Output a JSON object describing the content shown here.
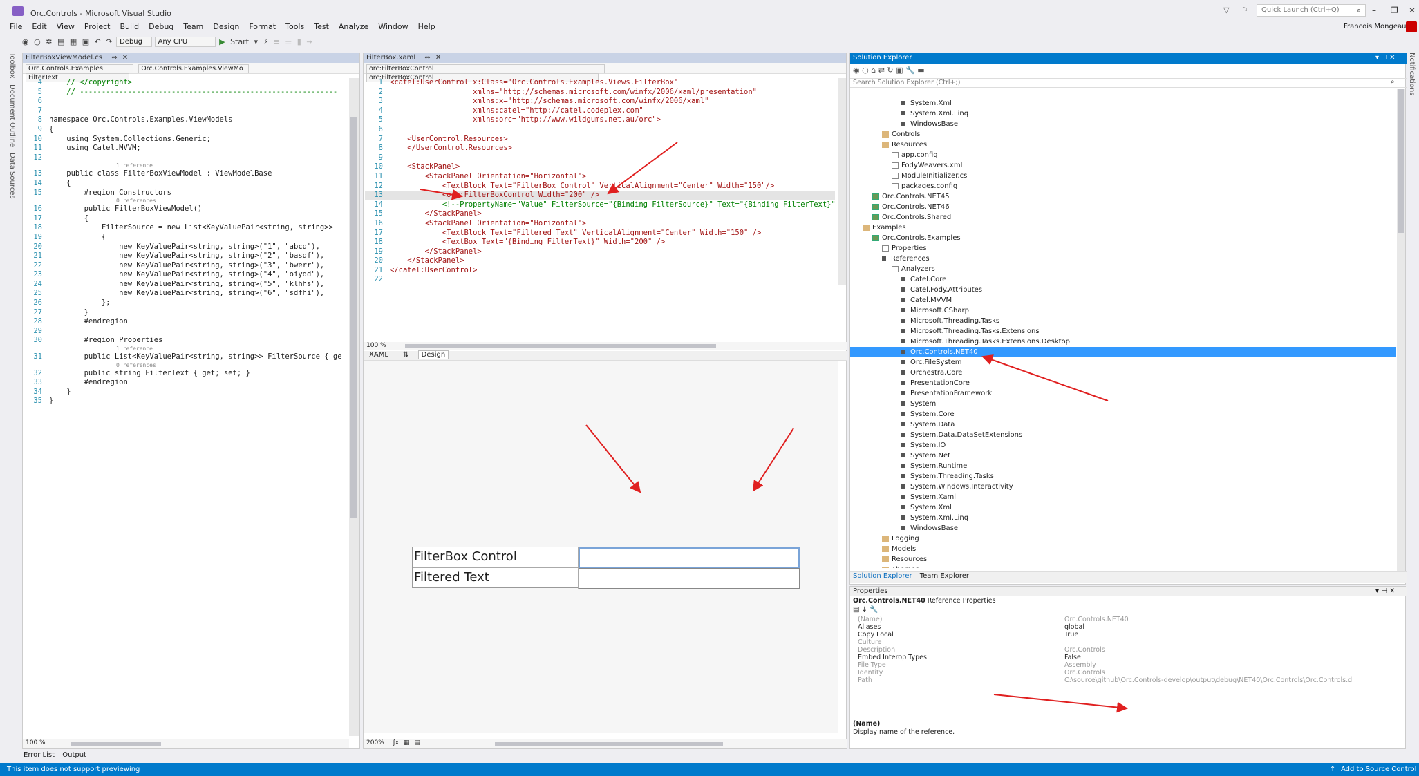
{
  "window": {
    "title": "Orc.Controls - Microsoft Visual Studio",
    "quick_launch_placeholder": "Quick Launch (Ctrl+Q)",
    "user": "Francois Mongeau"
  },
  "menu": [
    "File",
    "Edit",
    "View",
    "Project",
    "Build",
    "Debug",
    "Team",
    "Design",
    "Format",
    "Tools",
    "Test",
    "Analyze",
    "Window",
    "Help"
  ],
  "toolbar": {
    "config": "Debug",
    "platform": "Any CPU",
    "start": "Start"
  },
  "left_tabs": [
    "Toolbox",
    "Document Outline",
    "Data Sources"
  ],
  "right_tabs": [
    "Notifications"
  ],
  "cs_editor": {
    "tab": "FilterBoxViewModel.cs",
    "nav": [
      "Orc.Controls.Examples",
      "Orc.Controls.Examples.ViewMo",
      "FilterText"
    ],
    "zoom": "100 %",
    "lines": [
      {
        "n": "4",
        "t": "    // </copyright>"
      },
      {
        "n": "5",
        "t": "    // -----------------------------------------------------------"
      },
      {
        "n": "6",
        "t": ""
      },
      {
        "n": "7",
        "t": ""
      },
      {
        "n": "8",
        "t": "namespace Orc.Controls.Examples.ViewModels"
      },
      {
        "n": "9",
        "t": "{"
      },
      {
        "n": "10",
        "t": "    using System.Collections.Generic;"
      },
      {
        "n": "11",
        "t": "    using Catel.MVVM;"
      },
      {
        "n": "12",
        "t": ""
      },
      {
        "n": "",
        "t": "1 reference",
        "hint": true
      },
      {
        "n": "13",
        "t": "    public class FilterBoxViewModel : ViewModelBase"
      },
      {
        "n": "14",
        "t": "    {"
      },
      {
        "n": "15",
        "t": "        #region Constructors"
      },
      {
        "n": "",
        "t": "0 references",
        "hint": true
      },
      {
        "n": "16",
        "t": "        public FilterBoxViewModel()"
      },
      {
        "n": "17",
        "t": "        {"
      },
      {
        "n": "18",
        "t": "            FilterSource = new List<KeyValuePair<string, string>>"
      },
      {
        "n": "19",
        "t": "            {"
      },
      {
        "n": "20",
        "t": "                new KeyValuePair<string, string>(\"1\", \"abcd\"),"
      },
      {
        "n": "21",
        "t": "                new KeyValuePair<string, string>(\"2\", \"basdf\"),"
      },
      {
        "n": "22",
        "t": "                new KeyValuePair<string, string>(\"3\", \"bwerr\"),"
      },
      {
        "n": "23",
        "t": "                new KeyValuePair<string, string>(\"4\", \"oiydd\"),"
      },
      {
        "n": "24",
        "t": "                new KeyValuePair<string, string>(\"5\", \"klhhs\"),"
      },
      {
        "n": "25",
        "t": "                new KeyValuePair<string, string>(\"6\", \"sdfhi\"),"
      },
      {
        "n": "26",
        "t": "            };"
      },
      {
        "n": "27",
        "t": "        }"
      },
      {
        "n": "28",
        "t": "        #endregion"
      },
      {
        "n": "29",
        "t": ""
      },
      {
        "n": "30",
        "t": "        #region Properties"
      },
      {
        "n": "",
        "t": "1 reference",
        "hint": true
      },
      {
        "n": "31",
        "t": "        public List<KeyValuePair<string, string>> FilterSource { ge"
      },
      {
        "n": "",
        "t": "0 references",
        "hint": true
      },
      {
        "n": "32",
        "t": "        public string FilterText { get; set; }"
      },
      {
        "n": "33",
        "t": "        #endregion"
      },
      {
        "n": "34",
        "t": "    }"
      },
      {
        "n": "35",
        "t": "}"
      }
    ]
  },
  "xaml_editor": {
    "tab": "FilterBox.xaml",
    "nav": [
      "orc:FilterBoxControl",
      "orc:FilterBoxControl"
    ],
    "zoom": "100 %",
    "design_zoom": "200%",
    "tabs": [
      "XAML",
      "Design"
    ],
    "lines": [
      {
        "n": "1",
        "t": "<catel:UserControl x:Class=\"Orc.Controls.Examples.Views.FilterBox\""
      },
      {
        "n": "2",
        "t": "                   xmlns=\"http://schemas.microsoft.com/winfx/2006/xaml/presentation\""
      },
      {
        "n": "3",
        "t": "                   xmlns:x=\"http://schemas.microsoft.com/winfx/2006/xaml\""
      },
      {
        "n": "4",
        "t": "                   xmlns:catel=\"http://catel.codeplex.com\""
      },
      {
        "n": "5",
        "t": "                   xmlns:orc=\"http://www.wildgums.net.au/orc\">"
      },
      {
        "n": "6",
        "t": ""
      },
      {
        "n": "7",
        "t": "    <UserControl.Resources>"
      },
      {
        "n": "8",
        "t": "    </UserControl.Resources>"
      },
      {
        "n": "9",
        "t": ""
      },
      {
        "n": "10",
        "t": "    <StackPanel>"
      },
      {
        "n": "11",
        "t": "        <StackPanel Orientation=\"Horizontal\">"
      },
      {
        "n": "12",
        "t": "            <TextBlock Text=\"FilterBox Control\" VerticalAlignment=\"Center\" Width=\"150\"/>"
      },
      {
        "n": "13",
        "t": "            <orc:FilterBoxControl Width=\"200\" />"
      },
      {
        "n": "14",
        "t": "            <!--PropertyName=\"Value\" FilterSource=\"{Binding FilterSource}\" Text=\"{Binding FilterText}\" /"
      },
      {
        "n": "15",
        "t": "        </StackPanel>"
      },
      {
        "n": "16",
        "t": "        <StackPanel Orientation=\"Horizontal\">"
      },
      {
        "n": "17",
        "t": "            <TextBlock Text=\"Filtered Text\" VerticalAlignment=\"Center\" Width=\"150\" />"
      },
      {
        "n": "18",
        "t": "            <TextBox Text=\"{Binding FilterText}\" Width=\"200\" />"
      },
      {
        "n": "19",
        "t": "        </StackPanel>"
      },
      {
        "n": "20",
        "t": "    </StackPanel>"
      },
      {
        "n": "21",
        "t": "</catel:UserControl>"
      },
      {
        "n": "22",
        "t": ""
      }
    ],
    "design": {
      "row1": "FilterBox Control",
      "row2": "Filtered Text"
    }
  },
  "solution_explorer": {
    "title": "Solution Explorer",
    "search_placeholder": "Search Solution Explorer (Ctrl+;)",
    "items": [
      {
        "t": "System.Xml",
        "d": 5,
        "k": "ref"
      },
      {
        "t": "System.Xml.Linq",
        "d": 5,
        "k": "ref"
      },
      {
        "t": "WindowsBase",
        "d": 5,
        "k": "ref"
      },
      {
        "t": "Controls",
        "d": 3,
        "k": "folder"
      },
      {
        "t": "Resources",
        "d": 3,
        "k": "folder"
      },
      {
        "t": "app.config",
        "d": 4,
        "k": "file"
      },
      {
        "t": "FodyWeavers.xml",
        "d": 4,
        "k": "file"
      },
      {
        "t": "ModuleInitializer.cs",
        "d": 4,
        "k": "file"
      },
      {
        "t": "packages.config",
        "d": 4,
        "k": "file"
      },
      {
        "t": "Orc.Controls.NET45",
        "d": 2,
        "k": "proj"
      },
      {
        "t": "Orc.Controls.NET46",
        "d": 2,
        "k": "proj"
      },
      {
        "t": "Orc.Controls.Shared",
        "d": 2,
        "k": "proj"
      },
      {
        "t": "Examples",
        "d": 1,
        "k": "folder"
      },
      {
        "t": "Orc.Controls.Examples",
        "d": 2,
        "k": "proj"
      },
      {
        "t": "Properties",
        "d": 3,
        "k": "file"
      },
      {
        "t": "References",
        "d": 3,
        "k": "ref"
      },
      {
        "t": "Analyzers",
        "d": 4,
        "k": "file"
      },
      {
        "t": "Catel.Core",
        "d": 5,
        "k": "ref"
      },
      {
        "t": "Catel.Fody.Attributes",
        "d": 5,
        "k": "ref"
      },
      {
        "t": "Catel.MVVM",
        "d": 5,
        "k": "ref"
      },
      {
        "t": "Microsoft.CSharp",
        "d": 5,
        "k": "ref"
      },
      {
        "t": "Microsoft.Threading.Tasks",
        "d": 5,
        "k": "ref"
      },
      {
        "t": "Microsoft.Threading.Tasks.Extensions",
        "d": 5,
        "k": "ref"
      },
      {
        "t": "Microsoft.Threading.Tasks.Extensions.Desktop",
        "d": 5,
        "k": "ref"
      },
      {
        "t": "Orc.Controls.NET40",
        "d": 5,
        "k": "ref",
        "sel": true
      },
      {
        "t": "Orc.FileSystem",
        "d": 5,
        "k": "ref"
      },
      {
        "t": "Orchestra.Core",
        "d": 5,
        "k": "ref"
      },
      {
        "t": "PresentationCore",
        "d": 5,
        "k": "ref"
      },
      {
        "t": "PresentationFramework",
        "d": 5,
        "k": "ref"
      },
      {
        "t": "System",
        "d": 5,
        "k": "ref"
      },
      {
        "t": "System.Core",
        "d": 5,
        "k": "ref"
      },
      {
        "t": "System.Data",
        "d": 5,
        "k": "ref"
      },
      {
        "t": "System.Data.DataSetExtensions",
        "d": 5,
        "k": "ref"
      },
      {
        "t": "System.IO",
        "d": 5,
        "k": "ref"
      },
      {
        "t": "System.Net",
        "d": 5,
        "k": "ref"
      },
      {
        "t": "System.Runtime",
        "d": 5,
        "k": "ref"
      },
      {
        "t": "System.Threading.Tasks",
        "d": 5,
        "k": "ref"
      },
      {
        "t": "System.Windows.Interactivity",
        "d": 5,
        "k": "ref"
      },
      {
        "t": "System.Xaml",
        "d": 5,
        "k": "ref"
      },
      {
        "t": "System.Xml",
        "d": 5,
        "k": "ref"
      },
      {
        "t": "System.Xml.Linq",
        "d": 5,
        "k": "ref"
      },
      {
        "t": "WindowsBase",
        "d": 5,
        "k": "ref"
      },
      {
        "t": "Logging",
        "d": 3,
        "k": "folder"
      },
      {
        "t": "Models",
        "d": 3,
        "k": "folder"
      },
      {
        "t": "Resources",
        "d": 3,
        "k": "folder"
      },
      {
        "t": "Themes",
        "d": 3,
        "k": "folder"
      }
    ],
    "bottom_tabs": [
      "Solution Explorer",
      "Team Explorer"
    ]
  },
  "properties": {
    "title": "Properties",
    "object": "Orc.Controls.NET40",
    "object_type": "Reference Properties",
    "rows": [
      {
        "k": "(Name)",
        "v": "Orc.Controls.NET40",
        "dim": true
      },
      {
        "k": "Aliases",
        "v": "global"
      },
      {
        "k": "Copy Local",
        "v": "True"
      },
      {
        "k": "Culture",
        "v": "",
        "dim": true
      },
      {
        "k": "Description",
        "v": "Orc.Controls",
        "dim": true
      },
      {
        "k": "Embed Interop Types",
        "v": "False"
      },
      {
        "k": "File Type",
        "v": "Assembly",
        "dim": true
      },
      {
        "k": "Identity",
        "v": "Orc.Controls",
        "dim": true
      },
      {
        "k": "Path",
        "v": "C:\\source\\github\\Orc.Controls-develop\\output\\debug\\NET40\\Orc.Controls\\Orc.Controls.dl",
        "dim": true
      }
    ],
    "desc_title": "(Name)",
    "desc_text": "Display name of the reference."
  },
  "bottom_tabs": [
    "Error List",
    "Output"
  ],
  "status": {
    "left": "This item does not support previewing",
    "right": "Add to Source Control"
  }
}
